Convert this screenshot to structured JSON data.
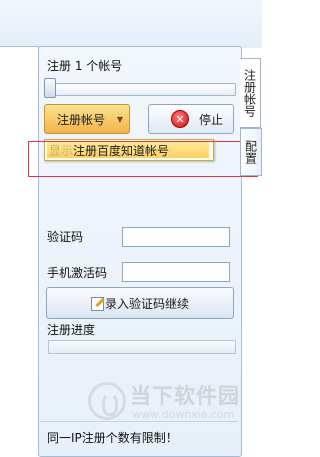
{
  "panel": {
    "account_count_label": "注册 1 个帐号",
    "slider_value": 1,
    "register_button_label": "注册帐号",
    "stop_button_label": "停止",
    "stop_icon_glyph": "✕",
    "dropdown_hint": "显示",
    "dropdown_item_label": "注册百度知道帐号",
    "captcha_label": "验证码",
    "captcha_value": "",
    "phone_code_label": "手机激活码",
    "phone_code_value": "",
    "verify_button_label": "录入验证码继续",
    "progress_label": "注册进度",
    "progress_fraction": 0,
    "footer_note": "同一IP注册个数有限制！"
  },
  "tabs": {
    "register_tab": "注册帐号",
    "config_tab": "配置"
  },
  "watermark": {
    "title": "当下软件园",
    "url": "www.downxia.com"
  },
  "colors": {
    "accent": "#f2b44a",
    "highlight_box": "#e0383a",
    "panel_border": "#a5bcd6"
  }
}
